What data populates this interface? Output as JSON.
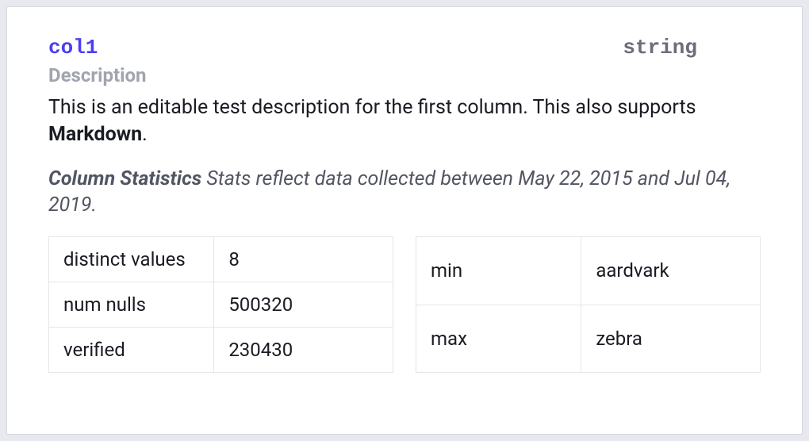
{
  "column": {
    "name": "col1",
    "type": "string",
    "description_label": "Description",
    "description_prefix": "This is an editable test description for the first column. This also supports ",
    "description_bold": "Markdown",
    "description_suffix": "."
  },
  "stats_caption": {
    "title": "Column Statistics",
    "text": " Stats reflect data collected between May 22, 2015 and Jul 04, 2019."
  },
  "stats_left": [
    {
      "label": "distinct values",
      "value": "8"
    },
    {
      "label": "num nulls",
      "value": "500320"
    },
    {
      "label": "verified",
      "value": "230430"
    }
  ],
  "stats_right": [
    {
      "label": "min",
      "value": "aardvark"
    },
    {
      "label": "max",
      "value": "zebra"
    }
  ]
}
